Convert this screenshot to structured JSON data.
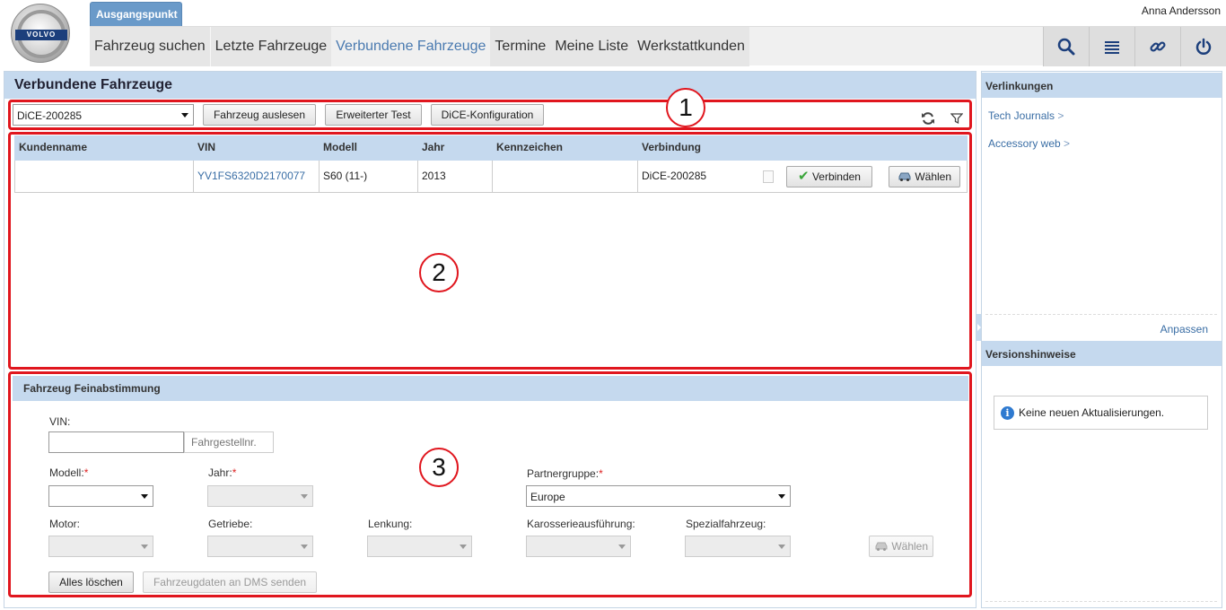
{
  "header": {
    "logo_text": "VOLVO",
    "start_tab": "Ausgangspunkt",
    "user_name": "Anna Andersson",
    "nav_tabs": [
      "Fahrzeug suchen",
      "Letzte Fahrzeuge",
      "Verbundene Fahrzeuge",
      "Termine",
      "Meine Liste",
      "Werkstattkunden"
    ],
    "active_tab": "Verbundene Fahrzeuge",
    "nav_icons": [
      "search-icon",
      "list-icon",
      "link-icon",
      "power-icon"
    ]
  },
  "main": {
    "title": "Verbundene Fahrzeuge",
    "annotations": [
      "1",
      "2",
      "3"
    ],
    "toolbar": {
      "device_select": "DiCE-200285",
      "read_vehicle": "Fahrzeug auslesen",
      "extended_test": "Erweiterter Test",
      "dice_config": "DiCE-Konfiguration",
      "icons": [
        "refresh-icon",
        "filter-icon"
      ]
    },
    "table": {
      "headers": [
        "Kundenname",
        "VIN",
        "Modell",
        "Jahr",
        "Kennzeichen",
        "Verbindung"
      ],
      "rows": [
        {
          "customer": "",
          "vin": "YV1FS6320D2170077",
          "model": "S60 (11-)",
          "year": "2013",
          "plate": "",
          "connection": "DiCE-200285",
          "connect_label": "Verbinden",
          "select_label": "Wählen"
        }
      ]
    },
    "fine_tuning": {
      "title": "Fahrzeug Feinabstimmung",
      "vin_label": "VIN:",
      "vin_value": "",
      "chassis_placeholder": "Fahrgestellnr.",
      "model_label": "Modell:",
      "year_label": "Jahr:",
      "partner_label": "Partnergruppe:",
      "partner_value": "Europe",
      "required_mark": "*",
      "motor_label": "Motor:",
      "gearbox_label": "Getriebe:",
      "steering_label": "Lenkung:",
      "body_label": "Karosserieausführung:",
      "special_label": "Spezialfahrzeug:",
      "select_label": "Wählen",
      "clear_all": "Alles löschen",
      "send_dms": "Fahrzeugdaten an DMS senden"
    }
  },
  "sidebar": {
    "links_title": "Verlinkungen",
    "links": [
      "Tech Journals",
      "Accessory web"
    ],
    "link_arrow": ">",
    "customize": "Anpassen",
    "release_title": "Versionshinweise",
    "release_message": "Keine neuen Aktualisierungen.",
    "info_glyph": "i"
  },
  "colors": {
    "accent": "#4a7ab0",
    "header_band": "#c5d9ee",
    "annotation": "#e0161e",
    "start_tab": "#6a9ac9"
  }
}
